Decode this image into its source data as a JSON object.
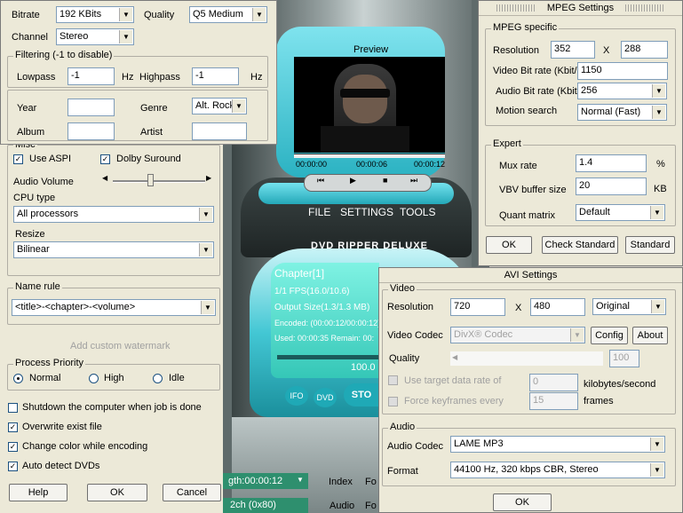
{
  "main": {
    "bitrate_label": "Bitrate",
    "bitrate_value": "192 KBits",
    "quality_label": "Quality",
    "quality_value": "Q5 Medium",
    "channel_label": "Channel",
    "channel_value": "Stereo",
    "filtering_label": "Filtering (-1 to disable)",
    "lowpass_label": "Lowpass",
    "lowpass_value": "-1",
    "hz1": "Hz",
    "highpass_label": "Highpass",
    "highpass_value": "-1",
    "hz2": "Hz",
    "year_label": "Year",
    "year_value": "",
    "genre_label": "Genre",
    "genre_value": "Alt. Rock",
    "album_label": "Album",
    "album_value": "",
    "artist_label": "Artist",
    "artist_value": "",
    "misc_label": "Misc",
    "use_aspi_label": "Use ASPI",
    "dolby_label": "Dolby Suround",
    "audio_volume_label": "Audio Volume",
    "audio_volume_level": 0.4,
    "cpu_type_label": "CPU type",
    "cpu_value": "All processors",
    "resize_label": "Resize",
    "resize_value": "Bilinear",
    "name_rule_label": "Name rule",
    "name_rule_value": "<title>-<chapter>-<volume>",
    "watermark_label": "Add custom watermark",
    "priority_label": "Process Priority",
    "priority_normal": "Normal",
    "priority_high": "High",
    "priority_idle": "Idle",
    "shutdown_label": "Shutdown the computer when job is done",
    "overwrite_label": "Overwrite exist file",
    "change_color_label": "Change color while encoding",
    "auto_detect_label": "Auto detect DVDs",
    "help_button": "Help",
    "ok_button": "OK",
    "cancel_button": "Cancel"
  },
  "player": {
    "preview_label": "Preview",
    "time_start": "00:00:00",
    "time_mid": "00:00:06",
    "time_end": "00:00:12",
    "menu_file": "FILE",
    "menu_settings": "SETTINGS",
    "menu_tools": "TOOLS",
    "brand": "DVD RIPPER DELUXE",
    "chapter": "Chapter[1]",
    "fps": "1/1 FPS(16.0/10.6)",
    "output_size": "Output Size(1.3/1.3 MB)",
    "encoded": "Encoded: (00:00:12/00:00:12)",
    "used": "Used: 00:00:35 Remain: 00:",
    "progress_pct": "100.0",
    "ifo": "IFO",
    "dvd": "DVD",
    "stop": "STO",
    "length_text": "gth:00:00:12",
    "audio_track": "2ch (0x80)",
    "tab_index": "Index",
    "tab_fo": "Fo",
    "tab_audio": "Audio",
    "tab_fo2": "Fo"
  },
  "mpeg": {
    "title": "MPEG Settings",
    "specific_label": "MPEG specific",
    "resolution_label": "Resolution",
    "res_w": "352",
    "x_label": "X",
    "res_h": "288",
    "video_bitrate_label": "Video Bit rate (Kbit/s)",
    "video_bitrate_value": "1150",
    "audio_bitrate_label": "Audio Bit rate (Kbit/s)",
    "audio_bitrate_value": "256",
    "motion_label": "Motion search",
    "motion_value": "Normal (Fast)",
    "expert_label": "Expert",
    "mux_label": "Mux rate",
    "mux_value": "1.4",
    "mux_unit": "%",
    "vbv_label": "VBV buffer size",
    "vbv_value": "20",
    "vbv_unit": "KB",
    "quant_label": "Quant matrix",
    "quant_value": "Default",
    "ok_button": "OK",
    "check_standard_button": "Check Standard",
    "standard_button": "Standard"
  },
  "avi": {
    "title": "AVI Settings",
    "video_label": "Video",
    "resolution_label": "Resolution",
    "res_w": "720",
    "x_label": "X",
    "res_h": "480",
    "res_mode": "Original",
    "codec_label": "Video Codec",
    "codec_value": "DivX® Codec",
    "config_button": "Config",
    "about_button": "About",
    "quality_label": "Quality",
    "quality_value": "100",
    "target_rate_label": "Use target data rate of",
    "target_rate_value": "0",
    "kbps_label": "kilobytes/second",
    "force_kf_label": "Force keyframes every",
    "force_kf_value": "15",
    "frames_label": "frames",
    "audio_label": "Audio",
    "audio_codec_label": "Audio Codec",
    "audio_codec_value": "LAME MP3",
    "format_label": "Format",
    "format_value": "44100 Hz, 320 kbps CBR, Stereo",
    "ok_button": "OK"
  }
}
